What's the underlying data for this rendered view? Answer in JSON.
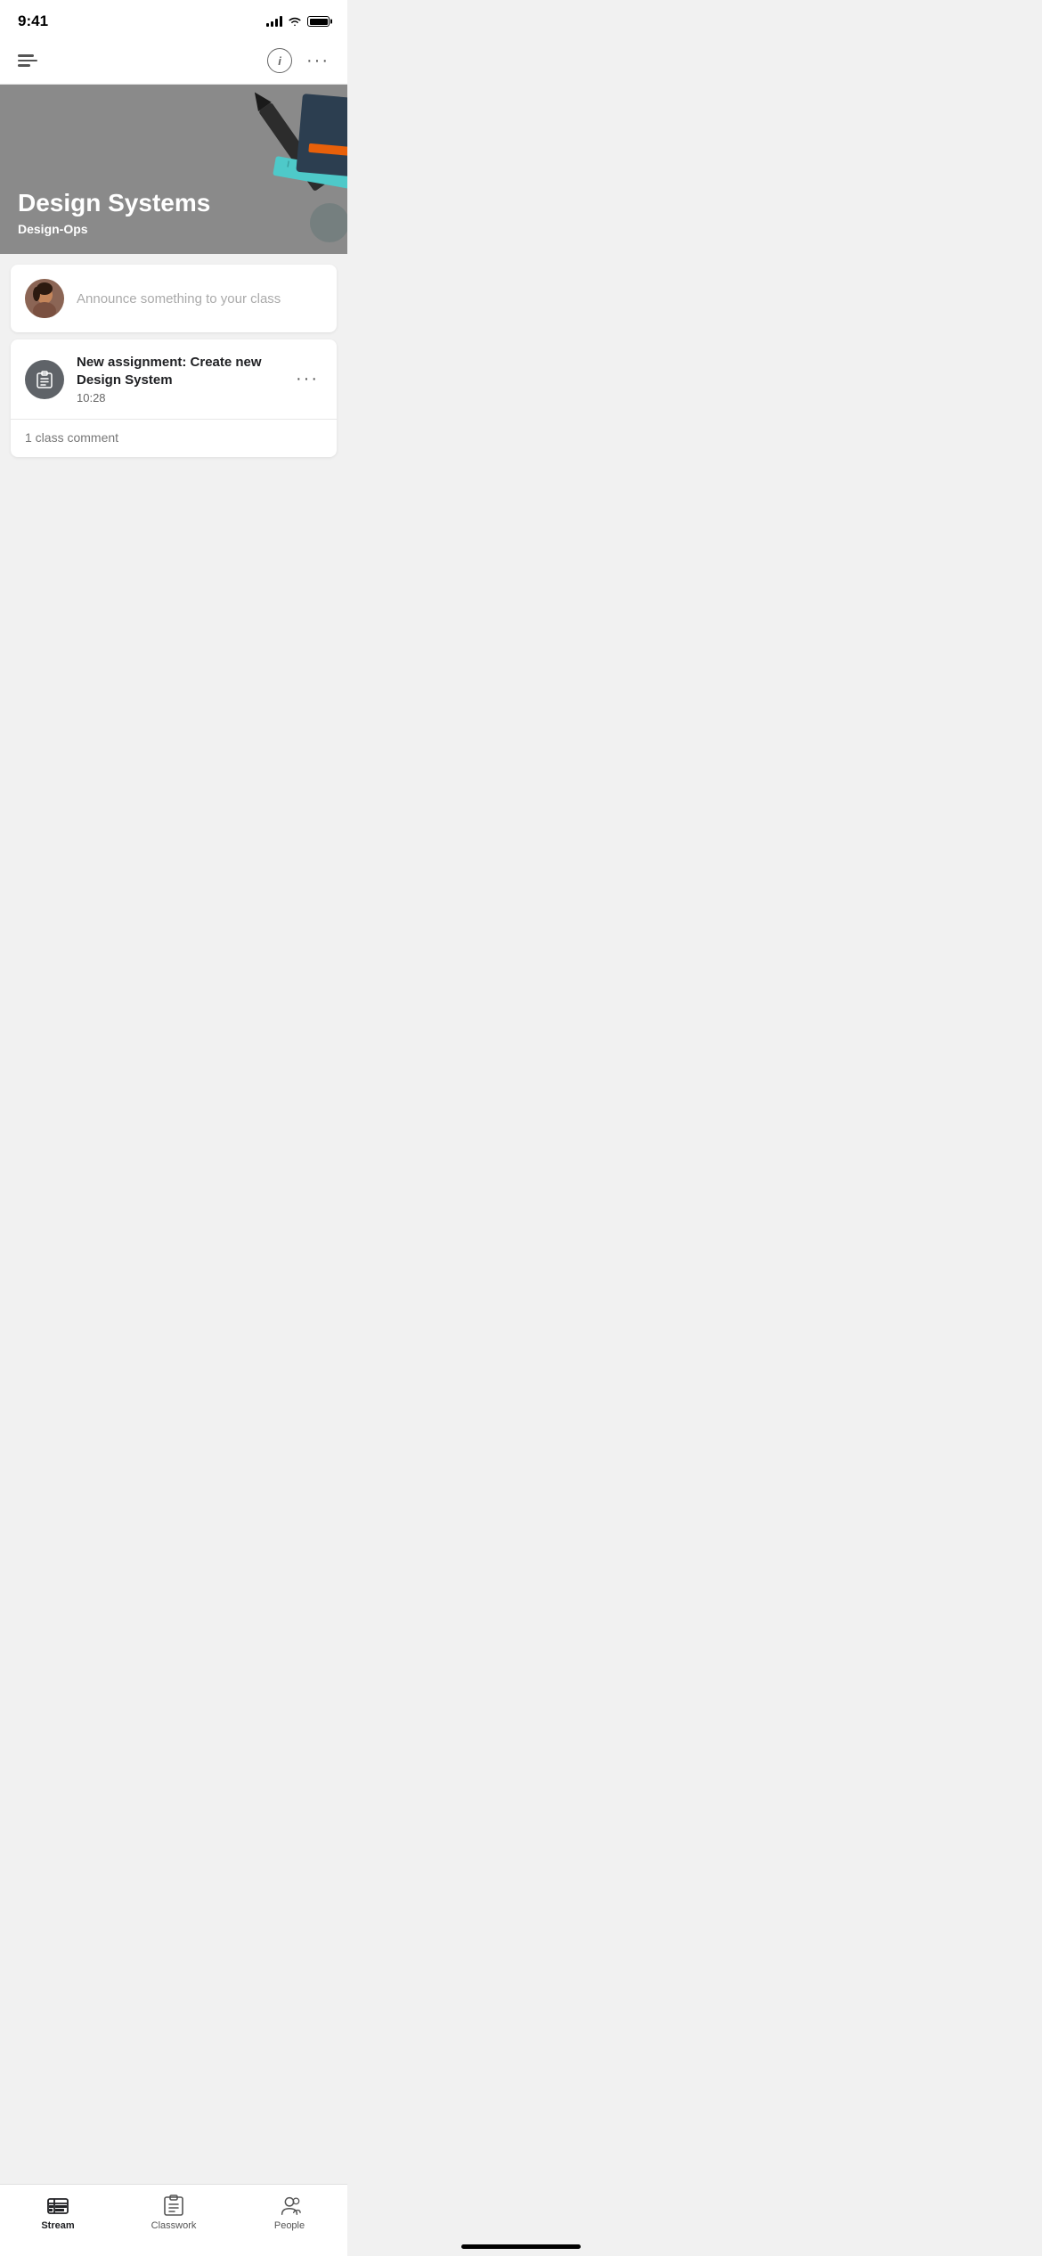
{
  "status": {
    "time": "9:41"
  },
  "header": {
    "info_label": "i",
    "more_label": "···"
  },
  "hero": {
    "title": "Design Systems",
    "subtitle": "Design-Ops"
  },
  "announce": {
    "placeholder": "Announce something to your class"
  },
  "assignment": {
    "title": "New assignment: Create new Design System",
    "time": "10:28",
    "comment_count": "1 class comment",
    "more_label": "···"
  },
  "bottom_nav": {
    "stream": "Stream",
    "classwork": "Classwork",
    "people": "People"
  }
}
